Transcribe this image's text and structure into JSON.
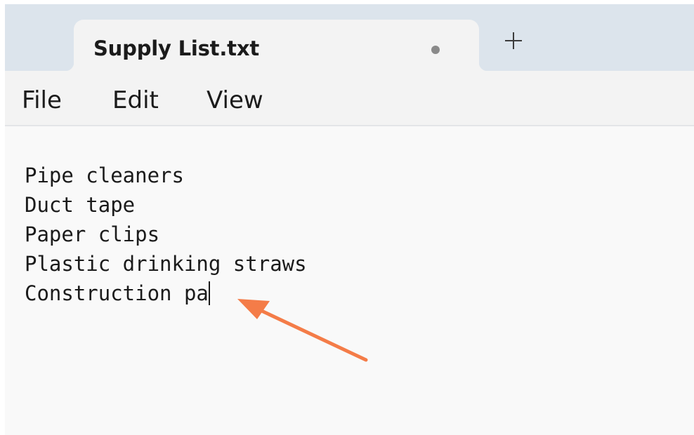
{
  "tab": {
    "title": "Supply List.txt",
    "unsaved_indicator": "dot-icon",
    "new_tab_icon": "plus-icon"
  },
  "menu": {
    "items": [
      "File",
      "Edit",
      "View"
    ]
  },
  "editor": {
    "lines": [
      "Pipe cleaners",
      "Duct tape",
      "Paper clips",
      "Plastic drinking straws",
      "Construction pa"
    ]
  },
  "annotation": {
    "type": "arrow",
    "color": "#f47c48",
    "points_to": "text-caret"
  }
}
